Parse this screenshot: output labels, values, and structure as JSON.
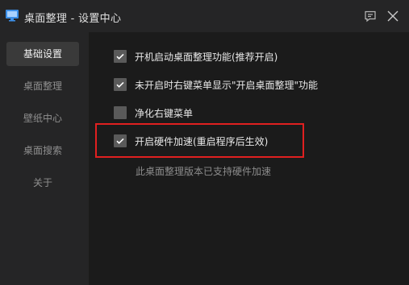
{
  "window": {
    "title": "桌面整理 - 设置中心"
  },
  "titlebar": {
    "feedback_icon": "feedback-icon",
    "close_icon": "close-icon"
  },
  "sidebar": {
    "items": [
      {
        "label": "基础设置",
        "active": true
      },
      {
        "label": "桌面整理",
        "active": false
      },
      {
        "label": "壁纸中心",
        "active": false
      },
      {
        "label": "桌面搜索",
        "active": false
      },
      {
        "label": "关于",
        "active": false
      }
    ]
  },
  "settings": {
    "options": [
      {
        "label": "开机启动桌面整理功能(推荐开启)",
        "checked": true
      },
      {
        "label": "未开启时右键菜单显示\"开启桌面整理\"功能",
        "checked": true
      },
      {
        "label": "净化右键菜单",
        "checked": false
      },
      {
        "label": "开启硬件加速(重启程序后生效)",
        "checked": true
      }
    ],
    "note": "此桌面整理版本已支持硬件加速"
  },
  "colors": {
    "highlight": "#e02020",
    "checkbox": "#5a5a5a",
    "active_item": "#3a3a3a"
  }
}
